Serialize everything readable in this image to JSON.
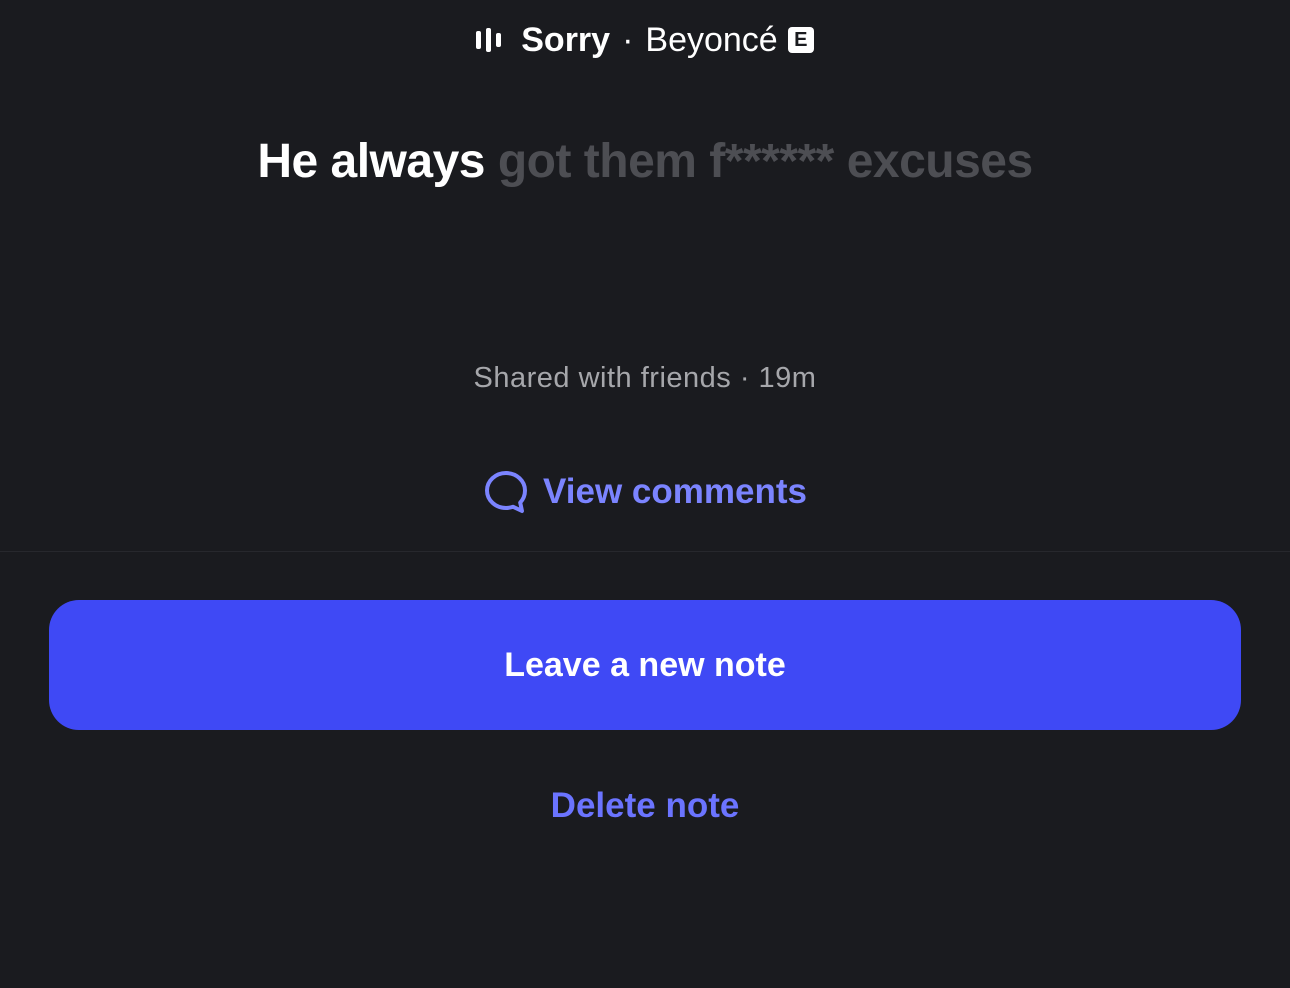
{
  "song": {
    "title": "Sorry",
    "separator": "·",
    "artist": "Beyoncé",
    "explicit_badge": "E"
  },
  "lyric": {
    "active": "He always",
    "inactive": "got them f****** excuses"
  },
  "note_meta": "Shared with friends · 19m",
  "view_comments_label": "View comments",
  "leave_note_label": "Leave a new note",
  "delete_note_label": "Delete note",
  "colors": {
    "background": "#1a1b1f",
    "accent": "#3f49f5",
    "link": "#7b84ff",
    "lyric_inactive": "#4d4e53",
    "meta_text": "#a6a7ab"
  },
  "icons": {
    "now_playing": "audio-bars-icon",
    "comments": "speech-bubble-icon"
  }
}
